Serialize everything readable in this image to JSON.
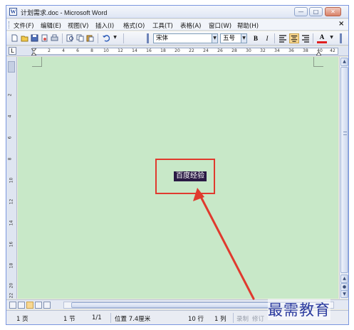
{
  "window": {
    "title": "计划需求.doc - Microsoft Word",
    "app_icon_glyph": "W",
    "controls": {
      "minimize": "—",
      "maximize": "□",
      "close": "✕"
    }
  },
  "menubar": {
    "items": [
      "文件(F)",
      "编辑(E)",
      "视图(V)",
      "插入(I)",
      "格式(O)",
      "工具(T)",
      "表格(A)",
      "窗口(W)",
      "帮助(H)"
    ],
    "doc_close": "×"
  },
  "toolbar": {
    "font_name": "宋体",
    "font_size": "五号",
    "bold": "B",
    "italic": "I",
    "font_color_glyph": "A",
    "active_alignment": "center"
  },
  "ruler": {
    "tab_selector": "L",
    "numbers": [
      "2",
      "4",
      "6",
      "8",
      "10",
      "12",
      "14",
      "16",
      "18",
      "20",
      "22",
      "24",
      "26",
      "28",
      "30",
      "32",
      "34",
      "36",
      "38",
      "40",
      "42"
    ]
  },
  "vertical_ruler": {
    "numbers": [
      "2",
      "4",
      "6",
      "8",
      "10",
      "12",
      "14",
      "16",
      "18",
      "20",
      "22"
    ]
  },
  "document": {
    "selected_text": "百度经验",
    "background_color": "#c8e8c8",
    "highlight_color": "#e03a2e"
  },
  "statusbar": {
    "page": "1 页",
    "section": "1 节",
    "page_of": "1/1",
    "position": "位置 7.4厘米",
    "line": "10 行",
    "column": "1 列",
    "record": "录制",
    "revision": "修订"
  },
  "watermark": {
    "text": "最需教育"
  },
  "icons": [
    "new-document-icon",
    "open-folder-icon",
    "save-icon",
    "permission-icon",
    "print-icon",
    "print-preview-icon",
    "copy-icon",
    "paste-icon",
    "undo-icon",
    "align-left-icon",
    "align-center-icon",
    "align-right-icon",
    "font-color-icon"
  ]
}
